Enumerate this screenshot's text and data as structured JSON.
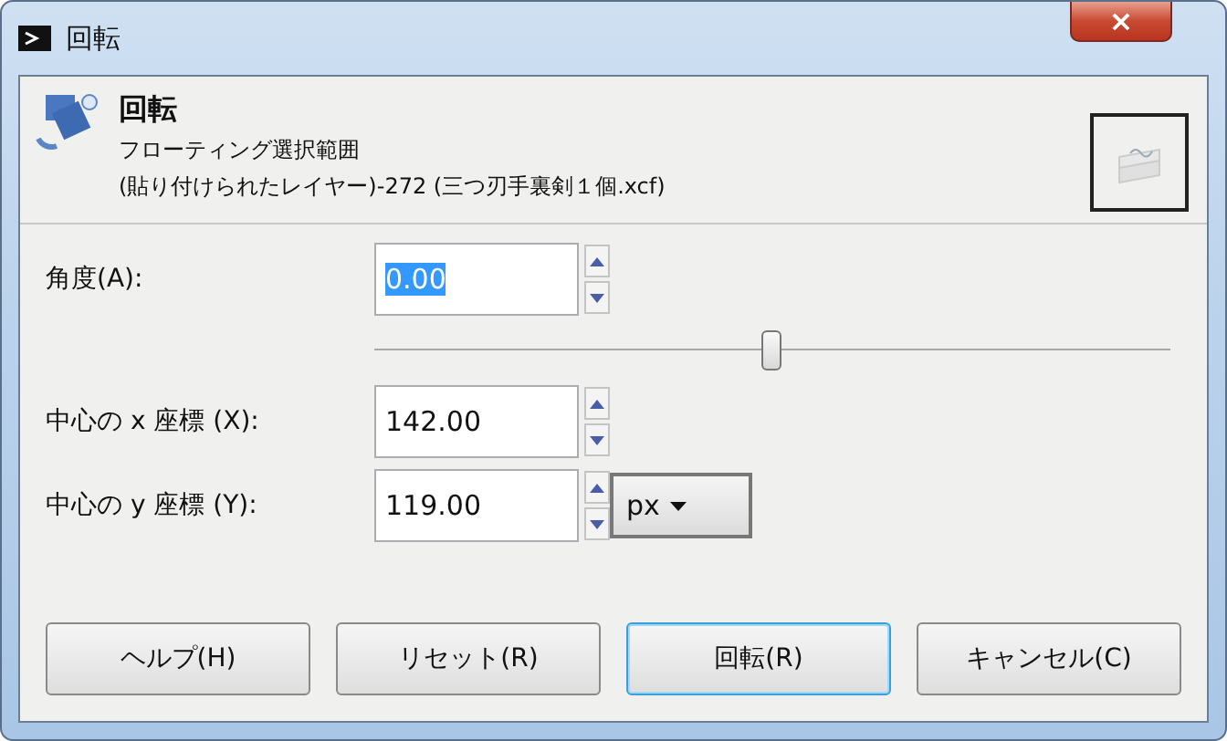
{
  "window": {
    "title": "回転",
    "close": "×"
  },
  "header": {
    "title": "回転",
    "subtitle": "フローティング選択範囲",
    "detail": "(貼り付けられたレイヤー)-272 (三つ刃手裏剣１個.xcf)"
  },
  "angle": {
    "label": "角度(A):",
    "value": "0.00",
    "selected": true,
    "slider": {
      "level": 0.5
    }
  },
  "center_x": {
    "label": "中心の x 座標 (X):",
    "value": "142.00"
  },
  "center_y": {
    "label": "中心の y 座標 (Y):",
    "value": "119.00"
  },
  "unit": {
    "value": "px"
  },
  "buttons": [
    {
      "label": "ヘルプ(H)",
      "default": false
    },
    {
      "label": "リセット(R)",
      "default": false
    },
    {
      "label": "回転(R)",
      "default": true
    },
    {
      "label": "キャンセル(C)",
      "default": false
    }
  ]
}
